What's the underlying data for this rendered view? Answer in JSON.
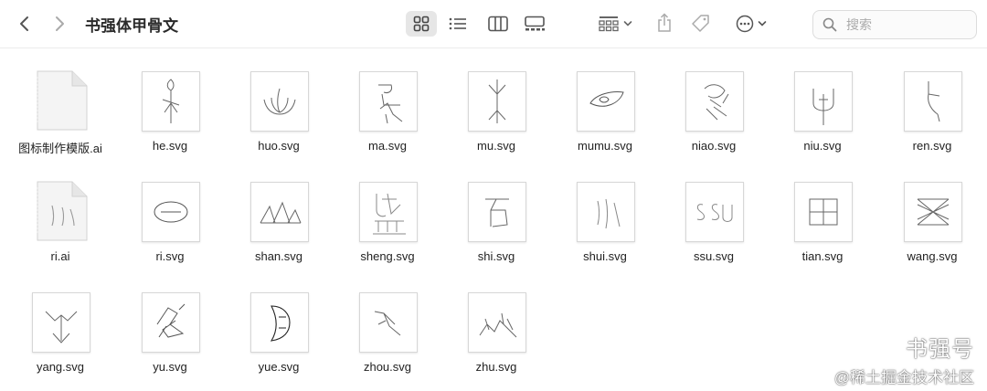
{
  "window": {
    "title": "书强体甲骨文"
  },
  "search": {
    "placeholder": "搜索"
  },
  "toolbar": {
    "icons": [
      "chevron-left-icon",
      "chevron-right-icon",
      "grid-view-icon",
      "list-view-icon",
      "column-view-icon",
      "gallery-view-icon",
      "group-icon",
      "share-icon",
      "tag-icon",
      "more-icon",
      "search-icon"
    ]
  },
  "files": [
    {
      "name": "图标制作模版.ai",
      "kind": "ai"
    },
    {
      "name": "he.svg",
      "kind": "svg"
    },
    {
      "name": "huo.svg",
      "kind": "svg"
    },
    {
      "name": "ma.svg",
      "kind": "svg"
    },
    {
      "name": "mu.svg",
      "kind": "svg"
    },
    {
      "name": "mumu.svg",
      "kind": "svg"
    },
    {
      "name": "niao.svg",
      "kind": "svg"
    },
    {
      "name": "niu.svg",
      "kind": "svg"
    },
    {
      "name": "ren.svg",
      "kind": "svg"
    },
    {
      "name": "ri.ai",
      "kind": "ai"
    },
    {
      "name": "ri.svg",
      "kind": "svg"
    },
    {
      "name": "shan.svg",
      "kind": "svg"
    },
    {
      "name": "sheng.svg",
      "kind": "svg"
    },
    {
      "name": "shi.svg",
      "kind": "svg"
    },
    {
      "name": "shui.svg",
      "kind": "svg"
    },
    {
      "name": "ssu.svg",
      "kind": "svg"
    },
    {
      "name": "tian.svg",
      "kind": "svg"
    },
    {
      "name": "wang.svg",
      "kind": "svg"
    },
    {
      "name": "yang.svg",
      "kind": "svg"
    },
    {
      "name": "yu.svg",
      "kind": "svg"
    },
    {
      "name": "yue.svg",
      "kind": "svg"
    },
    {
      "name": "zhou.svg",
      "kind": "svg"
    },
    {
      "name": "zhu.svg",
      "kind": "svg"
    }
  ],
  "watermark": {
    "line1": "书强号",
    "line2": "@稀土掘金技术社区"
  }
}
